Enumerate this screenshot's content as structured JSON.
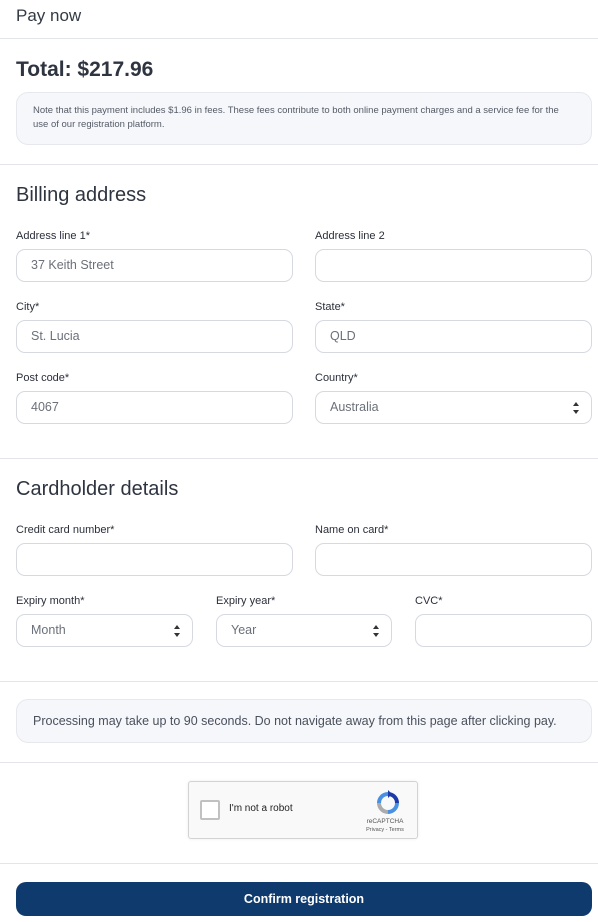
{
  "header": {
    "title": "Pay now"
  },
  "summary": {
    "total": "Total: $217.96",
    "note": "Note that this payment includes $1.96 in fees. These fees contribute to both online payment charges and a service fee for the use of our registration platform."
  },
  "billing": {
    "title": "Billing address",
    "address1": {
      "label": "Address line 1*",
      "value": "37 Keith Street"
    },
    "address2": {
      "label": "Address line 2",
      "value": ""
    },
    "city": {
      "label": "City*",
      "value": "St. Lucia"
    },
    "state": {
      "label": "State*",
      "value": "QLD"
    },
    "postcode": {
      "label": "Post code*",
      "value": "4067"
    },
    "country": {
      "label": "Country*",
      "value": "Australia"
    }
  },
  "cardholder": {
    "title": "Cardholder details",
    "card_number": {
      "label": "Credit card number*",
      "value": ""
    },
    "name_on_card": {
      "label": "Name on card*",
      "value": ""
    },
    "expiry_month": {
      "label": "Expiry month*",
      "value": "Month"
    },
    "expiry_year": {
      "label": "Expiry year*",
      "value": "Year"
    },
    "cvc": {
      "label": "CVC*",
      "value": ""
    }
  },
  "processing_note": "Processing may take up to 90 seconds. Do not navigate away from this page after clicking pay.",
  "captcha": {
    "label": "I'm not a robot",
    "brand": "reCAPTCHA",
    "links": "Privacy - Terms"
  },
  "confirm_label": "Confirm registration",
  "colors": {
    "primary_button": "#0f3a6e",
    "panel_bg": "#f6f7fb",
    "border": "#d6d9e0"
  }
}
